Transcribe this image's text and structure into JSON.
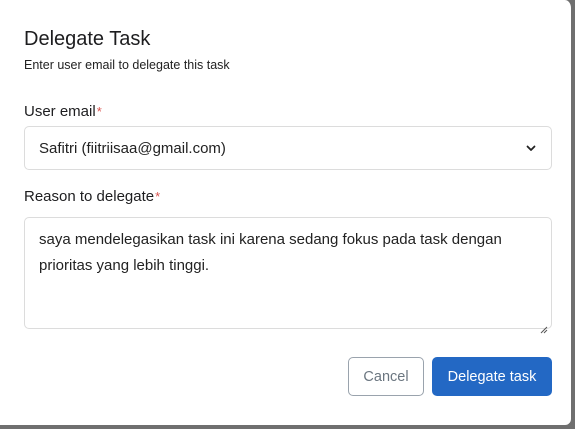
{
  "dialog": {
    "title": "Delegate Task",
    "subtitle": "Enter user email to delegate this task"
  },
  "email_field": {
    "label": "User email",
    "required_mark": "*",
    "selected_value": "Safitri (fiitriisaa@gmail.com)",
    "icon": "chevron-down-icon"
  },
  "reason_field": {
    "label": "Reason to delegate",
    "required_mark": "*",
    "value": "saya mendelegasikan task ini karena sedang fokus pada task dengan prioritas yang lebih tinggi."
  },
  "actions": {
    "cancel_label": "Cancel",
    "submit_label": "Delegate task"
  },
  "colors": {
    "primary": "#2368c4",
    "required": "#d9534f",
    "overlay": "#6f6f6f"
  }
}
